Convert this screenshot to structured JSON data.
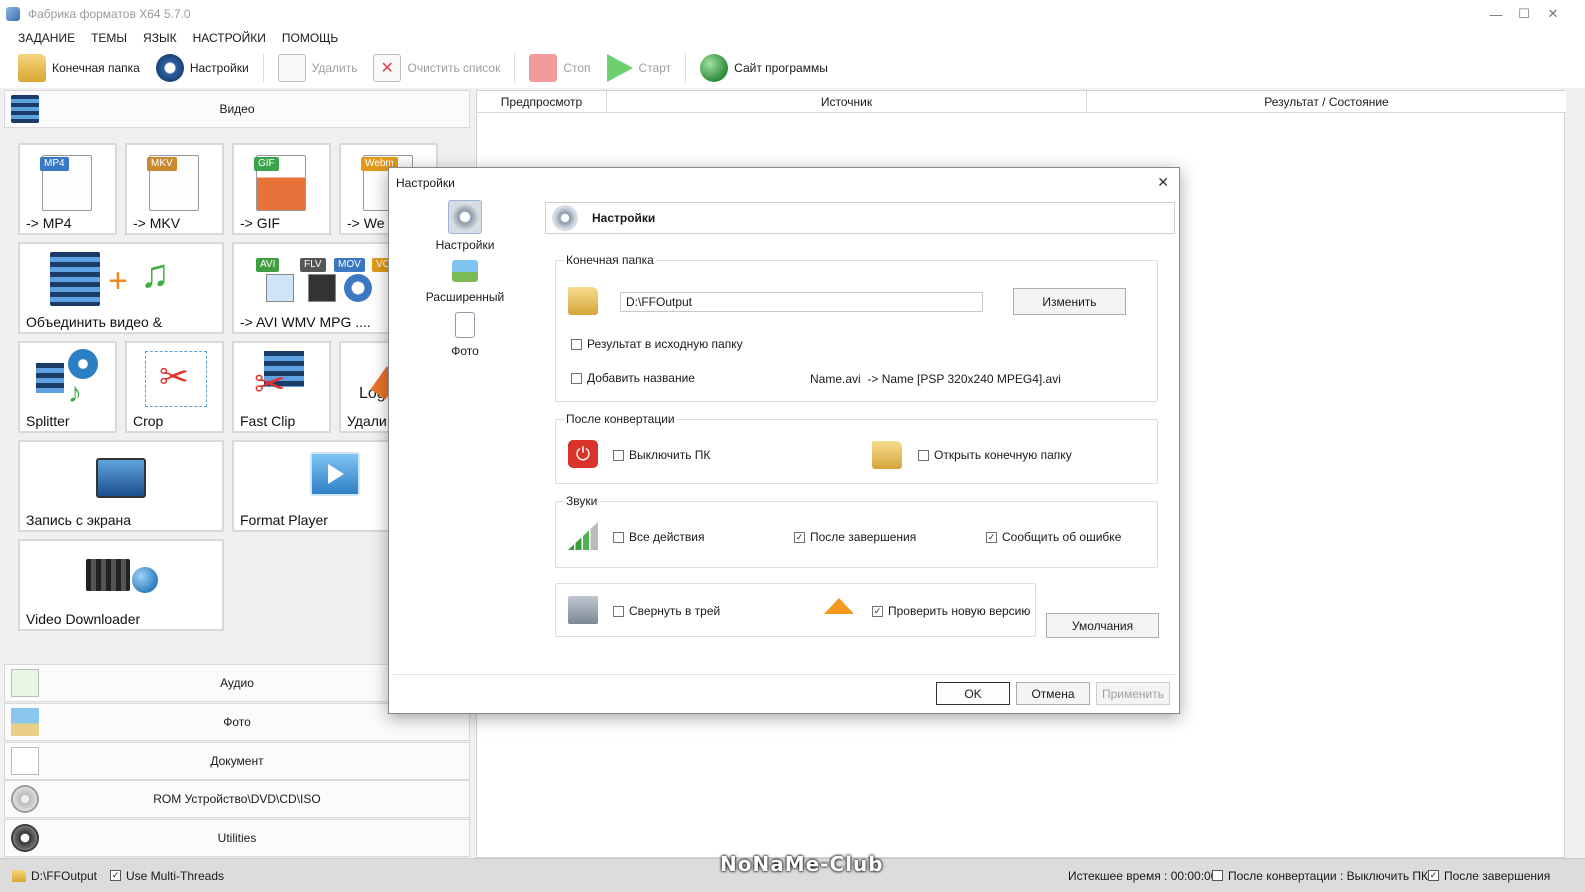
{
  "window": {
    "title": "Фабрика форматов X64 5.7.0",
    "min": "—",
    "max": "☐",
    "close": "✕"
  },
  "menu": [
    "ЗАДАНИЕ",
    "ТЕМЫ",
    "ЯЗЫК",
    "НАСТРОЙКИ",
    "ПОМОЩЬ"
  ],
  "toolbar": {
    "output_folder": "Конечная папка",
    "settings": "Настройки",
    "delete": "Удалить",
    "clear_list": "Очистить список",
    "stop": "Стоп",
    "start": "Старт",
    "website": "Сайт программы"
  },
  "categories": {
    "video": "Видео",
    "audio": "Аудио",
    "photo": "Фото",
    "document": "Документ",
    "rom": "ROM Устройство\\DVD\\CD\\ISO",
    "utilities": "Utilities"
  },
  "tiles": {
    "mp4": "-> MP4",
    "mkv": "-> MKV",
    "gif": "-> GIF",
    "webm": "-> We",
    "join": "Объединить видео &",
    "multi": "-> AVI WMV MPG ....",
    "splitter": "Splitter",
    "crop": "Crop",
    "fastclip": "Fast Clip",
    "remove_logo": "Удали",
    "logo_text": "Log",
    "screen_record": "Запись с экрана",
    "format_player": "Format Player",
    "video_downloader": "Video Downloader"
  },
  "badges": {
    "mp4": "MP4",
    "mkv": "MKV",
    "gif": "GIF",
    "webm": "Webm",
    "avi": "AVI",
    "flv": "FLV",
    "mov": "MOV",
    "vo": "VO"
  },
  "list": {
    "col_preview": "Предпросмотр",
    "col_source": "Источник",
    "col_result": "Результат / Состояние"
  },
  "statusbar": {
    "folder": "D:\\FFOutput",
    "multithreads": "Use Multi-Threads",
    "multithreads_checked": true,
    "elapsed": "Истекшее время : 00:00:00",
    "after_conv": "После конвертации : Выключить ПК",
    "after_conv_checked": false,
    "after_done": "После завершения",
    "after_done_checked": true
  },
  "watermark": "NoNaMe-Club",
  "dialog": {
    "title": "Настройки",
    "nav": [
      "Настройки",
      "Расширенный",
      "Фото"
    ],
    "header": "Настройки",
    "output_group": "Конечная папка",
    "output_path": "D:\\FFOutput",
    "change_btn": "Изменить",
    "result_to_source": "Результат в исходную папку",
    "add_name": "Добавить название",
    "name_example": "Name.avi  -> Name [PSP 320x240 MPEG4].avi",
    "after_group": "После конвертации",
    "shutdown_pc": "Выключить ПК",
    "open_folder": "Открыть конечную папку",
    "sounds_group": "Звуки",
    "all_actions": "Все действия",
    "after_finish": "После завершения",
    "report_error": "Сообщить об ошибке",
    "minimize_tray": "Свернуть в трей",
    "check_version": "Проверить новую версию",
    "defaults_btn": "Умолчания",
    "ok": "OK",
    "cancel": "Отмена",
    "apply": "Применить",
    "checked": {
      "result_to_source": false,
      "add_name": false,
      "shutdown_pc": false,
      "open_folder": false,
      "all_actions": false,
      "after_finish": true,
      "report_error": true,
      "minimize_tray": false,
      "check_version": true
    }
  }
}
